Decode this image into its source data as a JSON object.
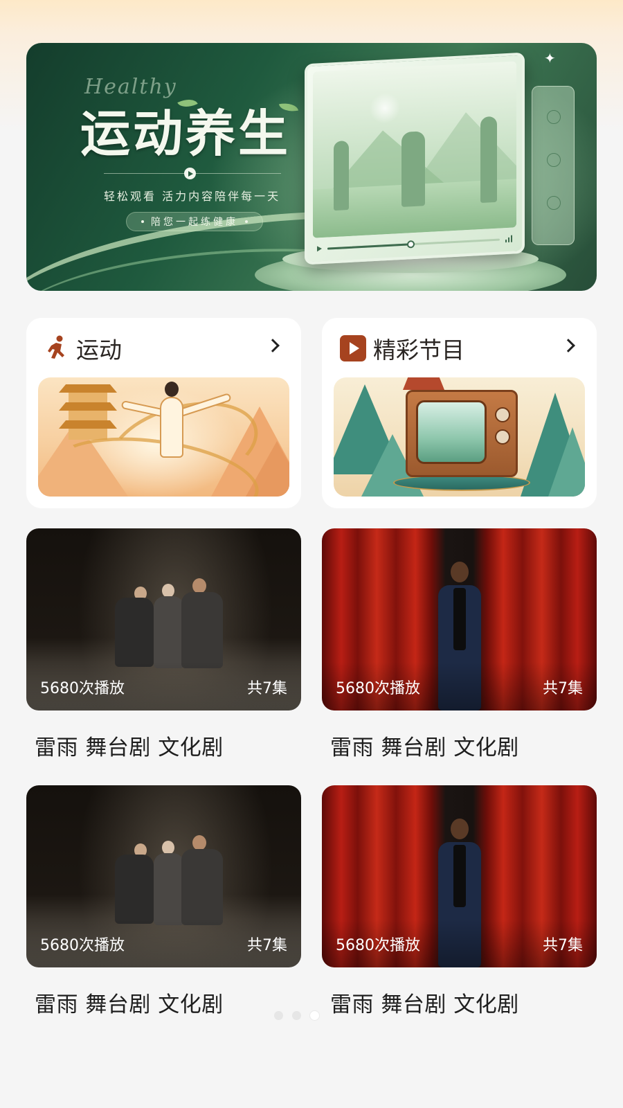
{
  "banner": {
    "script_text": "Healthy",
    "title": "运动养生",
    "subtitle": "轻松观看  活力内容陪伴每一天",
    "pill_text": "陪您一起练健康"
  },
  "categories": [
    {
      "title": "运动",
      "icon": "running-person-icon"
    },
    {
      "title": "精彩节目",
      "icon": "play-icon"
    }
  ],
  "videos": [
    {
      "plays": "5680次播放",
      "episodes": "共7集",
      "title": "雷雨 舞台剧 文化剧",
      "thumb": "stage-trio"
    },
    {
      "plays": "5680次播放",
      "episodes": "共7集",
      "title": "雷雨 舞台剧 文化剧",
      "thumb": "red-curtain"
    },
    {
      "plays": "5680次播放",
      "episodes": "共7集",
      "title": "雷雨 舞台剧 文化剧",
      "thumb": "stage-trio"
    },
    {
      "plays": "5680次播放",
      "episodes": "共7集",
      "title": "雷雨 舞台剧 文化剧",
      "thumb": "red-curtain"
    }
  ],
  "pager": {
    "count": 3,
    "active_index": 2
  },
  "colors": {
    "accent_brown": "#a6431f",
    "banner_green": "#1f5a3e",
    "page_bg": "#f5f5f5"
  }
}
